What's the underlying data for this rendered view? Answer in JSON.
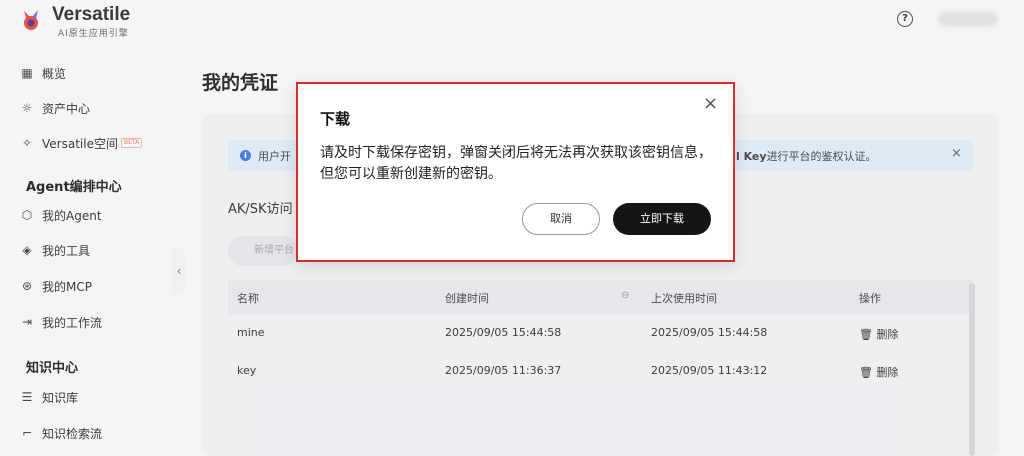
{
  "header": {
    "brand_name": "Versatile",
    "brand_sub": "AI原生应用引擎",
    "help_icon": "?"
  },
  "sidebar": {
    "items": [
      {
        "label": "概览",
        "icon": "grid-icon"
      },
      {
        "label": "资产中心",
        "icon": "bulb-icon"
      },
      {
        "label": "Versatile空间",
        "icon": "sparkle-icon",
        "badge": "BETA"
      }
    ],
    "section_agent": "Agent编排中心",
    "agent_items": [
      {
        "label": "我的Agent",
        "icon": "cube-icon"
      },
      {
        "label": "我的工具",
        "icon": "layers-icon"
      },
      {
        "label": "我的MCP",
        "icon": "mcp-icon"
      },
      {
        "label": "我的工作流",
        "icon": "flow-icon"
      }
    ],
    "section_knowledge": "知识中心",
    "knowledge_items": [
      {
        "label": "知识库",
        "icon": "database-icon"
      },
      {
        "label": "知识检索流",
        "icon": "retrieval-icon"
      }
    ]
  },
  "main": {
    "page_title": "我的凭证",
    "info_left": "用户开",
    "info_right_bold": "l Key",
    "info_right_rest": "进行平台的鉴权认证。",
    "info_close": "×",
    "sub_heading": "AK/SK访问",
    "new_button": "新增平台",
    "table": {
      "headers": [
        "名称",
        "创建时间",
        "上次使用时间",
        "操作"
      ],
      "sort_icon": "⊖",
      "rows": [
        {
          "name": "mine",
          "created": "2025/09/05 15:44:58",
          "last_used": "2025/09/05 15:44:58",
          "action": "删除"
        },
        {
          "name": "key",
          "created": "2025/09/05 11:36:37",
          "last_used": "2025/09/05 11:43:12",
          "action": "删除"
        }
      ]
    }
  },
  "modal": {
    "title": "下载",
    "message": "请及时下载保存密钥，弹窗关闭后将无法再次获取该密钥信息，但您可以重新创建新的密钥。",
    "cancel_label": "取消",
    "download_label": "立即下载",
    "close_symbol": "×",
    "border_color": "#d32f2f"
  }
}
